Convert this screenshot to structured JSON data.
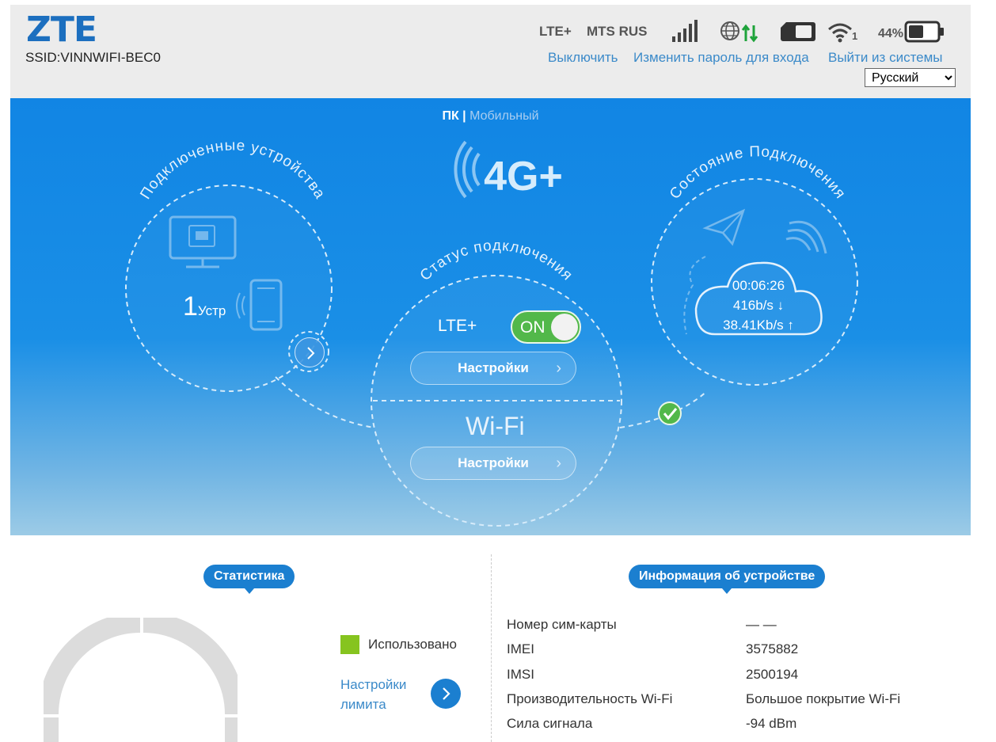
{
  "header": {
    "logo": "ZTE",
    "ssid": "SSID:VINNWIFI-BEC0",
    "network_type": "LTE+",
    "operator": "MTS RUS",
    "wifi_clients": "1",
    "battery": "44%",
    "links": {
      "shutdown": "Выключить",
      "change_password": "Изменить пароль для входа",
      "logout": "Выйти из системы"
    },
    "language": {
      "selected": "Русский"
    }
  },
  "hero": {
    "mode_pc": "ПК",
    "mode_sep": "|",
    "mode_mobile": "Мобильный",
    "badge": "4G+",
    "devices": {
      "title": "Подключенные устройства",
      "count": "1",
      "unit": "Устр"
    },
    "status": {
      "title": "Статус подключения",
      "lte_label": "LTE+",
      "toggle_label": "ON",
      "lte_settings": "Настройки",
      "wifi_label": "Wi-Fi",
      "wifi_settings": "Настройки"
    },
    "connection": {
      "title": "Состояние Подключения",
      "duration": "00:06:26",
      "download": "416b/s ↓",
      "upload": "38.41Kb/s ↑"
    }
  },
  "statistics": {
    "title": "Статистика",
    "legend_used": "Использовано",
    "limit_settings_line1": "Настройки",
    "limit_settings_line2": "лимита"
  },
  "device_info": {
    "title": "Информация об устройстве",
    "rows": [
      {
        "label": "Номер сим-карты",
        "value": "— —"
      },
      {
        "label": "IMEI",
        "value": "3575882"
      },
      {
        "label": "IMSI",
        "value": "2500194"
      },
      {
        "label": "Производительность Wi-Fi",
        "value": "Большое покрытие Wi-Fi"
      },
      {
        "label": "Сила сигнала",
        "value": "-94 dBm"
      }
    ]
  },
  "colors": {
    "brand": "#1c6fbf",
    "link": "#3b8ac9",
    "hero_top": "#1185e4",
    "toggle_on": "#52b84a",
    "legend_used": "#86c41f"
  }
}
